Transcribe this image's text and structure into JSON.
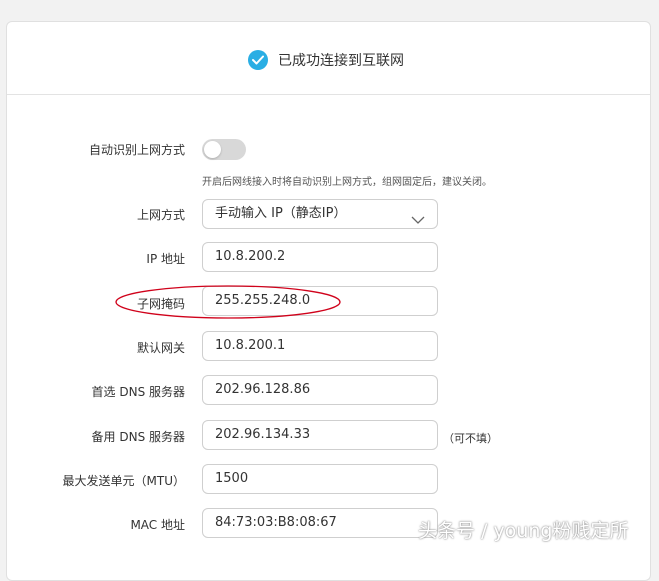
{
  "status": {
    "text": "已成功连接到互联网"
  },
  "form": {
    "auto_detect": {
      "label": "自动识别上网方式",
      "enabled": false,
      "hint": "开启后网线接入时将自动识别上网方式，组网固定后，建议关闭。"
    },
    "mode": {
      "label": "上网方式",
      "value": "手动输入 IP（静态IP）"
    },
    "ip": {
      "label": "IP 地址",
      "value": "10.8.200.2"
    },
    "subnet": {
      "label": "子网掩码",
      "value": "255.255.248.0"
    },
    "gateway": {
      "label": "默认网关",
      "value": "10.8.200.1"
    },
    "dns_primary": {
      "label": "首选 DNS 服务器",
      "value": "202.96.128.86"
    },
    "dns_secondary": {
      "label": "备用 DNS 服务器",
      "value": "202.96.134.33",
      "note": "（可不填）"
    },
    "mtu": {
      "label": "最大发送单元（MTU）",
      "value": "1500"
    },
    "mac": {
      "label": "MAC 地址",
      "value": "84:73:03:B8:08:67"
    }
  },
  "watermark": "头条号 / young粉贱定所",
  "colors": {
    "accent": "#2aaee4",
    "annotation": "#d0021b",
    "toggle_off": "#d8d8d8"
  },
  "icons": {
    "status": "check-circle-icon",
    "select": "chevron-down-icon"
  }
}
